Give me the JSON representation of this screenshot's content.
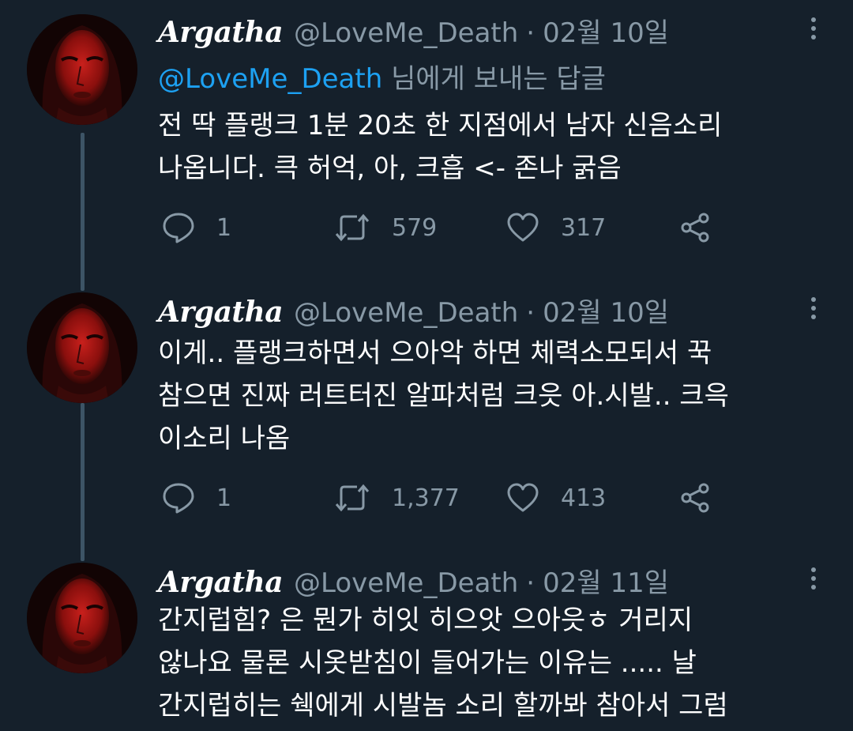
{
  "tweets": [
    {
      "display_name": "Argatha",
      "handle": "@LoveMe_Death",
      "separator": "·",
      "date": "02월 10일",
      "reply_to_handle": "@LoveMe_Death",
      "reply_to_suffix": " 님에게 보내는 답글",
      "body_lines": [
        "전 딱 플랭크 1분 20초 한 지점에서 남자 신음소리",
        "나옵니다. 큭 허억, 아, 크흡 <- 존나 굵음"
      ],
      "replies": "1",
      "retweets": "579",
      "likes": "317"
    },
    {
      "display_name": "Argatha",
      "handle": "@LoveMe_Death",
      "separator": "·",
      "date": "02월 10일",
      "body_lines": [
        "이게.. 플랭크하면서 으아악 하면 체력소모되서 꾹",
        "참으면 진짜 러트터진 알파처럼 크읏 아.시발.. 크윽",
        "이소리 나옴"
      ],
      "replies": "1",
      "retweets": "1,377",
      "likes": "413"
    },
    {
      "display_name": "Argatha",
      "handle": "@LoveMe_Death",
      "separator": "·",
      "date": "02월 11일",
      "body_lines": [
        "간지럽힘? 은 뭔가 히잇 히으앗 으아읏ㅎ 거리지",
        "않나요 물론 시옷받침이 들어가는 이유는 ..... 날",
        "간지럽히는 쉑에게 시발놈 소리 할까봐 참아서 그럼"
      ]
    }
  ],
  "colors": {
    "background": "#15202b",
    "text_primary": "#ffffff",
    "text_secondary": "#8899a6",
    "link": "#1da1f2",
    "thread_line": "#3d5466"
  },
  "icons": [
    "more-vertical-icon",
    "reply-icon",
    "retweet-icon",
    "like-icon",
    "share-icon"
  ]
}
